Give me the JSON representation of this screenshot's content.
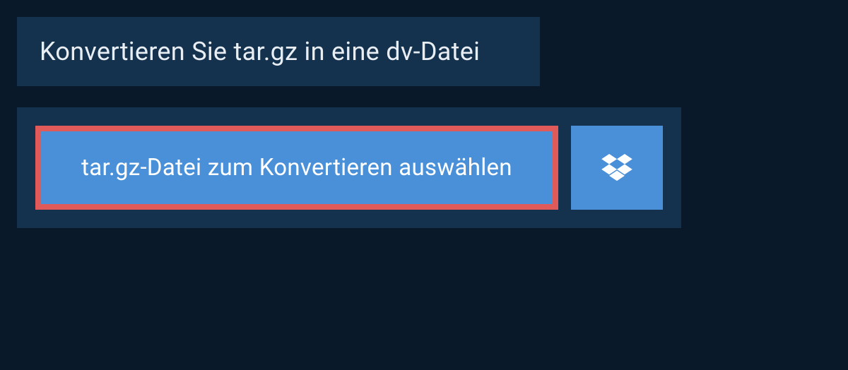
{
  "header": {
    "title": "Konvertieren Sie tar.gz in eine dv-Datei"
  },
  "upload": {
    "select_button_label": "tar.gz-Datei zum Konvertieren auswählen",
    "dropbox_icon_name": "dropbox-icon"
  },
  "colors": {
    "background": "#0a1929",
    "panel": "#14324e",
    "button": "#4a90d9",
    "highlight_border": "#e05a5a",
    "text_light": "#e8eef3"
  }
}
